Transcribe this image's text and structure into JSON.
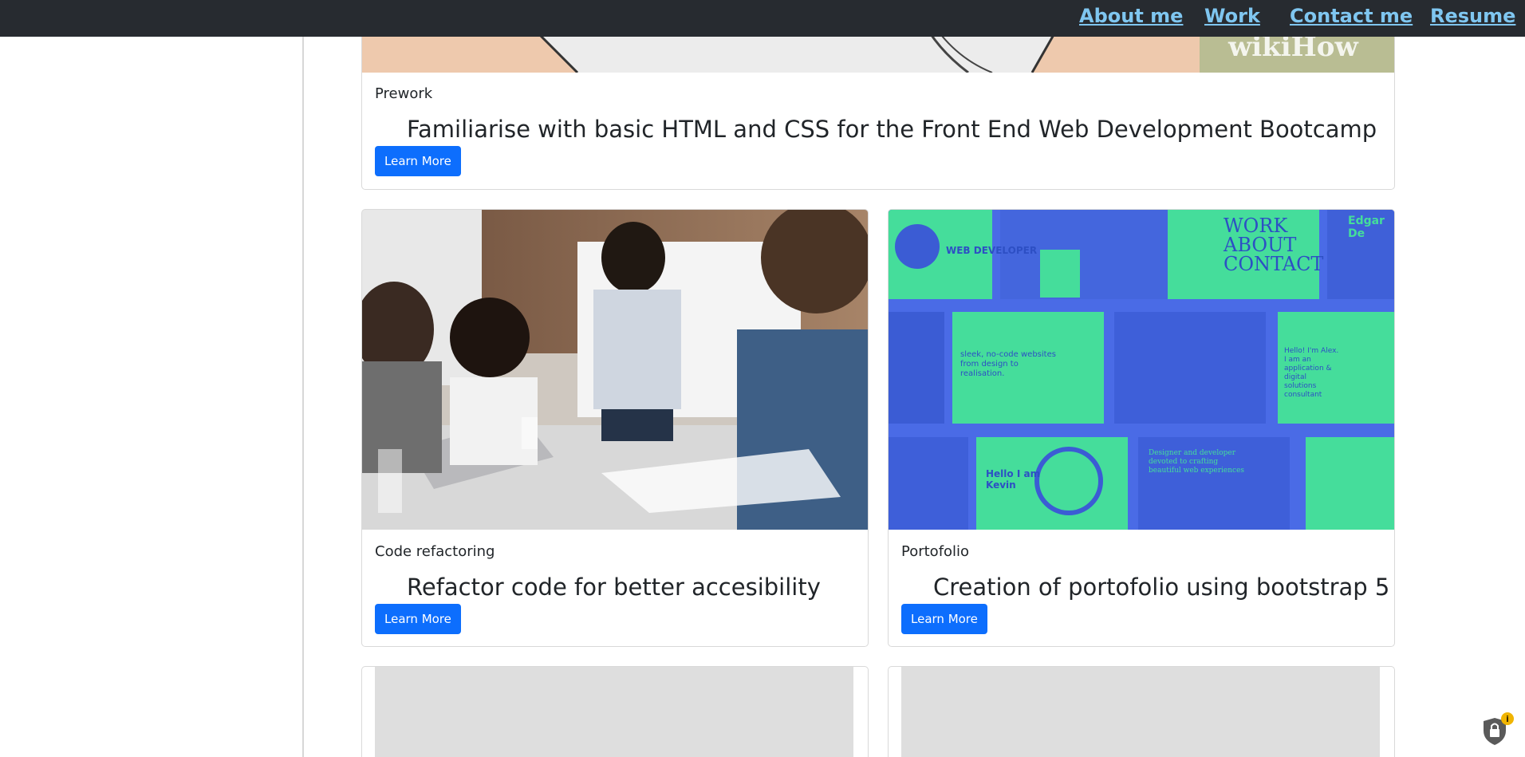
{
  "nav": {
    "items": [
      {
        "label": "About me"
      },
      {
        "label": "Work"
      },
      {
        "label": "Contact me"
      },
      {
        "label": "Resume"
      }
    ]
  },
  "cards": [
    {
      "subtitle": "Prework",
      "title": "Familiarise with basic HTML and CSS for the Front End Web Development Bootcamp",
      "button": "Learn More",
      "image": {
        "watermark": "wikiHow"
      }
    },
    {
      "subtitle": "Code refactoring",
      "title": "Refactor code for better accesibility",
      "button": "Learn More"
    },
    {
      "subtitle": "Portofolio",
      "title": "Creation of portofolio using bootstrap 5",
      "button": "Learn More",
      "image": {
        "texts": {
          "dev": "WEB DEVELOPER",
          "work": "WORK",
          "about": "ABOUT",
          "contact": "CONTACT",
          "name": "Edgar De",
          "sleek": "sleek, no-code websites from design to realisation.",
          "hello_alex": "Hello! I'm Alex. I am an application & digital solutions consultant",
          "hello_kevin": "Hello I am Kevin",
          "designer": "Designer and developer devoted to crafting beautiful web experiences"
        }
      }
    }
  ],
  "colors": {
    "nav_bg": "#272b30",
    "nav_link": "#7fc6f0",
    "button": "#0d6efd",
    "portfolio_green": "#45dd9b",
    "portfolio_blue": "#4a6be6"
  },
  "icons": [
    "shield-lock-icon",
    "info-badge-icon"
  ]
}
